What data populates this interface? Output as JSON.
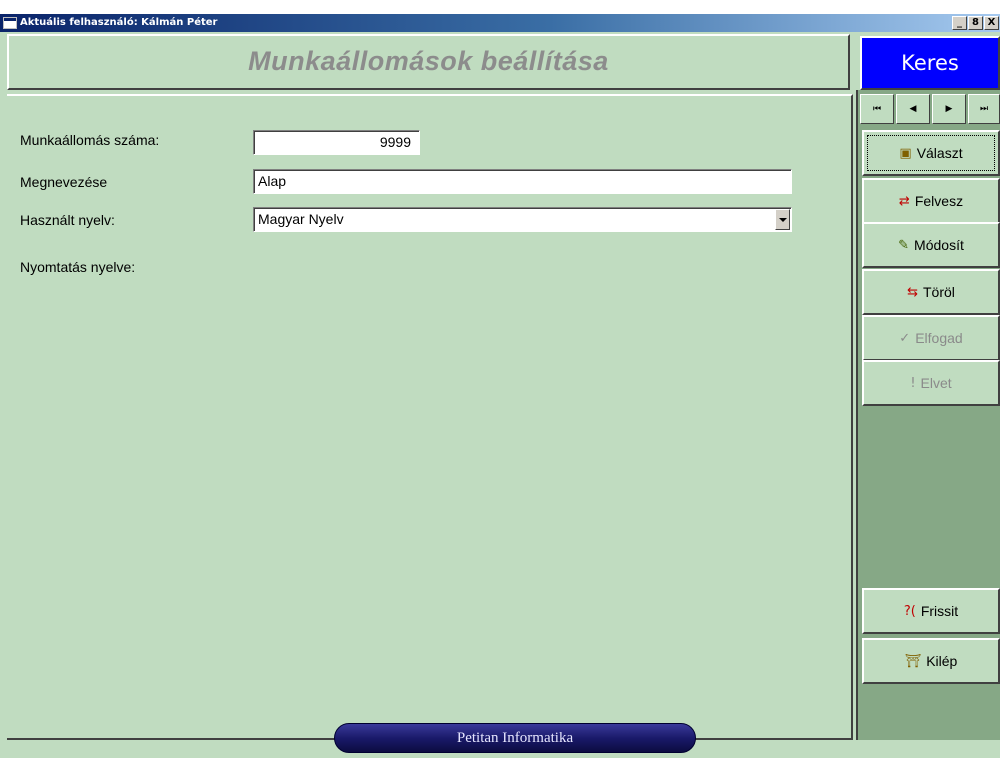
{
  "window": {
    "title": "Aktuális felhasználó: Kálmán Péter",
    "minimize_label": "_",
    "maximize_label": "8",
    "close_label": "X"
  },
  "header": {
    "title": "Munkaállomások beállítása",
    "search_button": "Keres"
  },
  "form": {
    "station_number_label": "Munkaállomás száma:",
    "station_number_value": "9999",
    "name_label": "Megnevezése",
    "name_value": "Alap",
    "language_label": "Használt nyelv:",
    "language_value": "Magyar Nyelv",
    "print_language_label": "Nyomtatás nyelve:"
  },
  "navigation": {
    "first": "⏮",
    "prev": "◀",
    "next": "▶",
    "last": "⏭"
  },
  "side_buttons": {
    "valaszt": "Választ",
    "felvesz": "Felvesz",
    "modosit": "Módosít",
    "torol": "Töröl",
    "elfogad": "Elfogad",
    "elvet": "Elvet",
    "frissit": "Frissit",
    "kilep": "Kilép"
  },
  "footer": {
    "brand": "Petitan Informatika"
  },
  "colors": {
    "background": "#c0dcc0",
    "search_button": "#0000ff",
    "side_panel": "#86a886",
    "brand_pill": "#1a1a6a"
  }
}
